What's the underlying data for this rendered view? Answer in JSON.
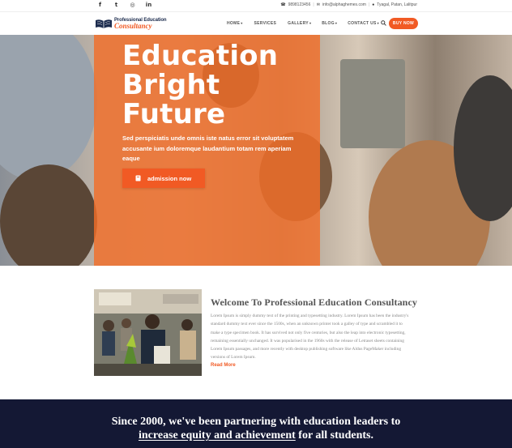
{
  "topbar": {
    "social": [
      {
        "icon": "facebook-icon",
        "glyph": "f"
      },
      {
        "icon": "twitter-icon",
        "glyph": "t"
      },
      {
        "icon": "instagram-icon",
        "glyph": "◎"
      },
      {
        "icon": "linkedin-icon",
        "glyph": "in"
      }
    ],
    "phone": "9898123456",
    "email": "info@alphaghemes.com",
    "address": "Tyagal, Patan, Lalitpur"
  },
  "header": {
    "logo_line1": "Professional Education",
    "logo_line2": "Consultancy",
    "nav": [
      {
        "label": "HOME",
        "dropdown": true
      },
      {
        "label": "SERVICES",
        "dropdown": false
      },
      {
        "label": "GALLERY",
        "dropdown": true
      },
      {
        "label": "BLOG",
        "dropdown": true
      },
      {
        "label": "CONTACT US",
        "dropdown": true
      }
    ],
    "buy_label": "BUY NOW"
  },
  "hero": {
    "title_line1": "Education",
    "title_line2": "Bright",
    "title_line3": "Future",
    "subtitle": "Sed perspiciatis unde omnis iste natus error sit voluptatem accusante ium doloremque laudantium totam rem aperiam eaque",
    "button_label": "admission now"
  },
  "welcome": {
    "title": "Welcome To Professional Education Consultancy",
    "body": "Lorem Ipsum is simply dummy text of the printing and typesetting industry. Lorem Ipsum has been the industry's standard dummy text ever since the 1500s, when an unknown printer took a galley of type and scrambled it to make a type specimen book. It has survived not only five centuries, but also the leap into electronic typesetting, remaining essentially unchanged. It was popularised in the 1960s with the release of Letraset sheets containing Lorem Ipsum passages, and more recently with desktop publishing software like Aldus PageMaker including versions of Lorem Ipsum.",
    "read_more": "Read More"
  },
  "band": {
    "line1": "Since 2000, we've been partnering with education leaders to",
    "line2_link": "increase equity and achievement",
    "line2_rest": " for all students."
  },
  "colors": {
    "accent": "#f15a24",
    "navy": "#141834",
    "logo_navy": "#1b2b4d"
  }
}
